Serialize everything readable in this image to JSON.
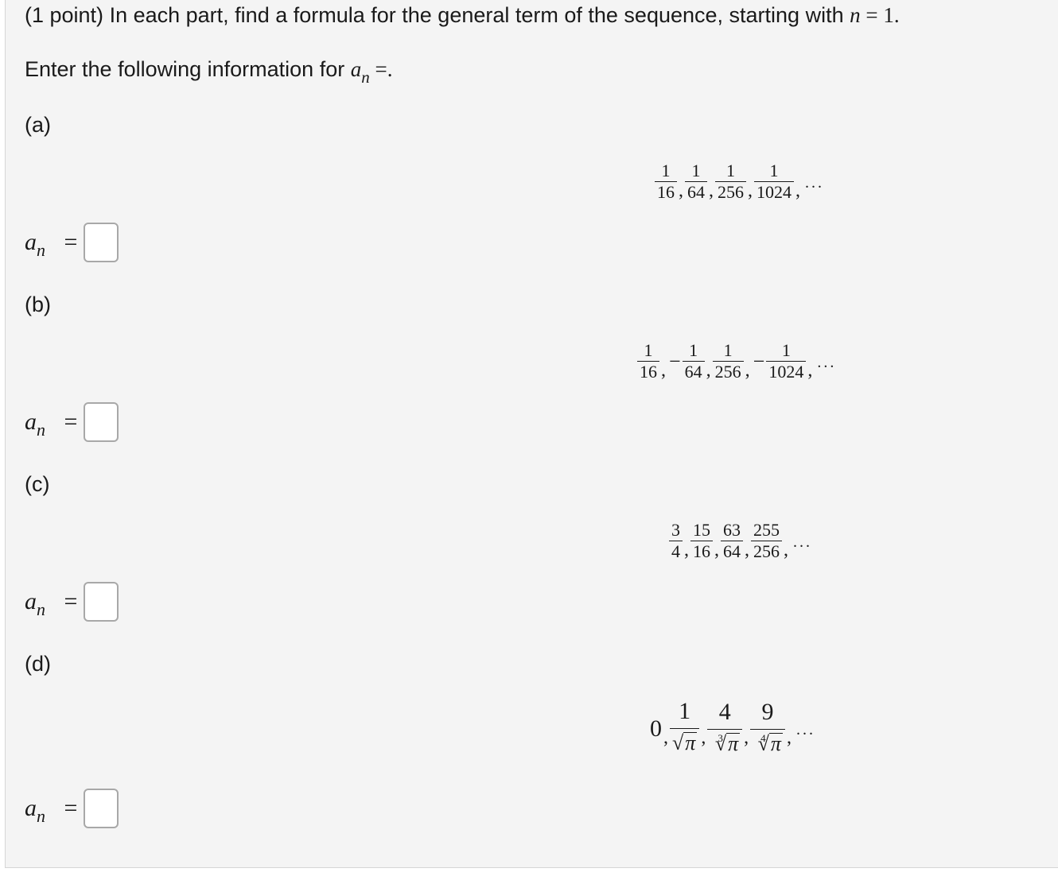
{
  "header": {
    "points": "(1 point)",
    "instruction": "In each part, find a formula for the general term of the sequence, starting with",
    "n_symbol": "n",
    "eq_one": " = 1."
  },
  "prompt": {
    "text": "Enter the following information for",
    "a_symbol": "a",
    "n_sub": "n",
    "tail": " =."
  },
  "answer_lhs": {
    "a": "a",
    "n": "n",
    "eq": "="
  },
  "parts": [
    {
      "label": "(a)",
      "terms": [
        {
          "num": "1",
          "den": "16"
        },
        {
          "num": "1",
          "den": "64"
        },
        {
          "num": "1",
          "den": "256"
        },
        {
          "num": "1",
          "den": "1024"
        }
      ],
      "answer": ""
    },
    {
      "label": "(b)",
      "terms": [
        {
          "num": "1",
          "den": "16",
          "sign": ""
        },
        {
          "num": "1",
          "den": "64",
          "sign": "−"
        },
        {
          "num": "1",
          "den": "256",
          "sign": ""
        },
        {
          "num": "1",
          "den": "1024",
          "sign": "−"
        }
      ],
      "answer": ""
    },
    {
      "label": "(c)",
      "terms": [
        {
          "num": "3",
          "den": "4"
        },
        {
          "num": "15",
          "den": "16"
        },
        {
          "num": "63",
          "den": "64"
        },
        {
          "num": "255",
          "den": "256"
        }
      ],
      "answer": ""
    },
    {
      "label": "(d)",
      "first": "0",
      "terms": [
        {
          "num": "1",
          "root_index": "",
          "radicand": "π"
        },
        {
          "num": "4",
          "root_index": "3",
          "radicand": "π"
        },
        {
          "num": "9",
          "root_index": "4",
          "radicand": "π"
        }
      ],
      "answer": ""
    }
  ],
  "separators": {
    "comma": ",",
    "ellipsis": "..."
  }
}
